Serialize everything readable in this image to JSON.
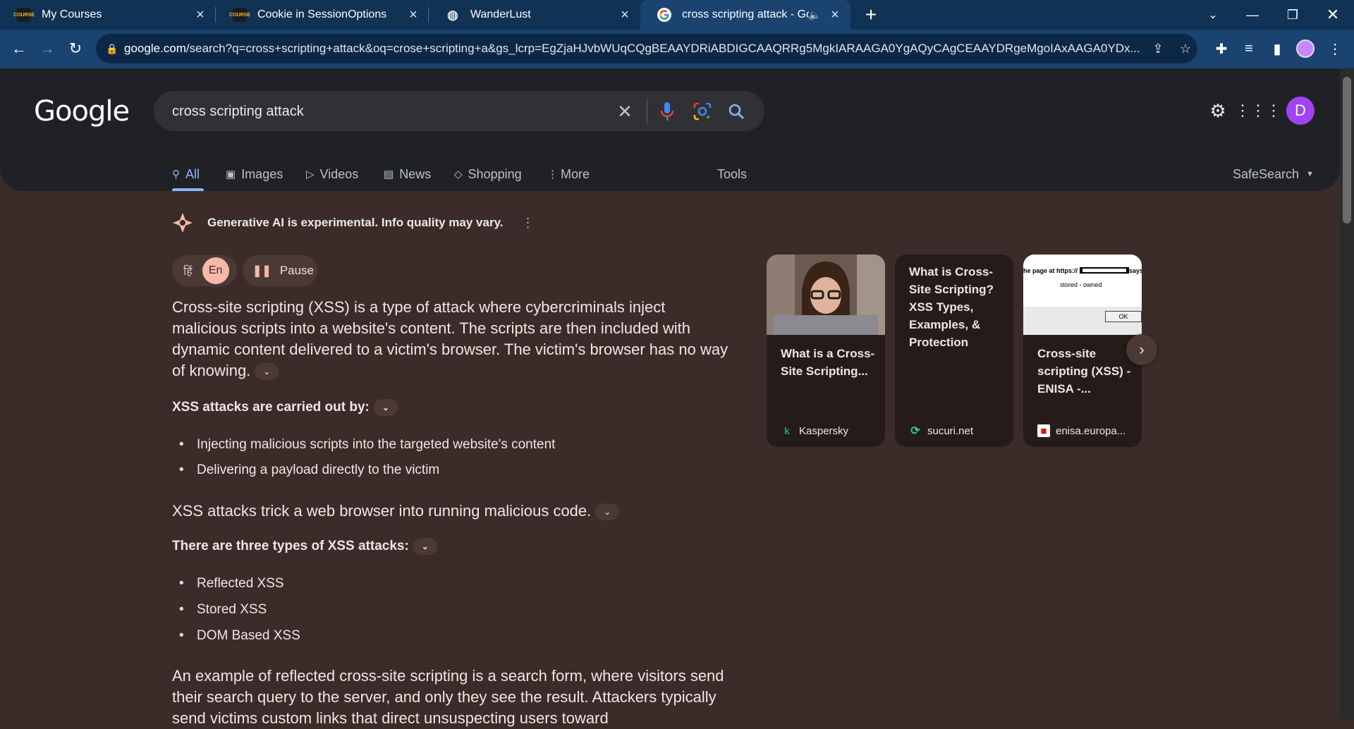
{
  "browser": {
    "tabs": [
      {
        "title": "My Courses",
        "favicon": "course-logo-icon",
        "active": false
      },
      {
        "title": "Cookie in SessionOptions",
        "favicon": "course-logo-icon",
        "active": false
      },
      {
        "title": "WanderLust",
        "favicon": "globe-icon",
        "active": false
      },
      {
        "title": "cross scripting attack - Goog",
        "favicon": "google-g-icon",
        "active": true
      }
    ],
    "tab_favicon_text": "COURSE",
    "address": {
      "host": "google.com",
      "path": "/search?q=cross+scripting+attack&oq=crose+scripting+a&gs_lcrp=EgZjaHJvbWUqCQgBEAAYDRiABDIGCAAQRRg5MgkIARAAGA0YgAQyCAgCEAAYDRgeMgoIAxAAGA0YDx..."
    }
  },
  "google": {
    "logo_text": "Google",
    "search_query": "cross scripting attack",
    "avatar_letter": "D",
    "tabs": [
      {
        "label": "All",
        "icon": "search-icon",
        "active": true
      },
      {
        "label": "Images",
        "icon": "image-icon"
      },
      {
        "label": "Videos",
        "icon": "video-icon"
      },
      {
        "label": "News",
        "icon": "news-icon"
      },
      {
        "label": "Shopping",
        "icon": "tag-icon"
      },
      {
        "label": "More",
        "icon": "more-vert-icon"
      }
    ],
    "tools_label": "Tools",
    "safesearch_label": "SafeSearch"
  },
  "ai_overview": {
    "banner": "Generative AI is experimental. Info quality may vary.",
    "lang_hi": "हिं",
    "lang_en": "En",
    "pause_label": "Pause",
    "intro": "Cross-site scripting (XSS) is a type of attack where cybercriminals inject malicious scripts into a website's content. The scripts are then included with dynamic content delivered to a victim's browser. The victim's browser has no way of knowing.",
    "carried_heading": "XSS attacks are carried out by:",
    "carried_items": [
      "Injecting malicious scripts into the targeted website's content",
      "Delivering a payload directly to the victim"
    ],
    "trick_text": "XSS attacks trick a web browser into running malicious code.",
    "types_heading": "There are three types of XSS attacks:",
    "types_items": [
      "Reflected XSS",
      "Stored XSS",
      "DOM Based XSS"
    ],
    "example_text": "An example of reflected cross-site scripting is a search form, where visitors send their search query to the server, and only they see the result. Attackers typically send victims custom links that direct unsuspecting users toward"
  },
  "sources": [
    {
      "title": "What is a Cross-Site Scripting...",
      "site": "Kaspersky",
      "favicon": "kaspersky-icon"
    },
    {
      "title": "What is Cross-Site Scripting? XSS Types, Examples, & Protection",
      "site": "sucuri.net",
      "favicon": "sucuri-icon"
    },
    {
      "title": "Cross-site scripting (XSS) - ENISA -...",
      "site": "enisa.europa...",
      "favicon": "enisa-icon"
    }
  ],
  "dialog_thumb": {
    "heading": "he page at https://",
    "says": "says",
    "message": "stored - owned",
    "ok": "OK"
  },
  "colors": {
    "tabstrip": "#103255",
    "toolbar": "#1a4370",
    "page_bg": "#3c2c29",
    "header_bg": "#202124",
    "accent_blue": "#8ab4f8",
    "avatar": "#a142f4"
  }
}
